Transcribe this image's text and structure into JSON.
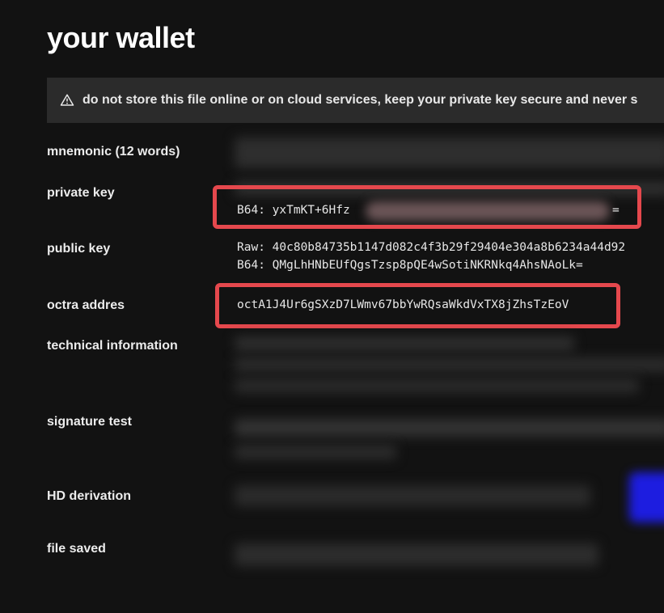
{
  "page": {
    "title": "your wallet"
  },
  "warning": {
    "icon": "warning-triangle-icon",
    "text": "do not store this file online or on cloud services, keep your private key secure and never s"
  },
  "fields": {
    "mnemonic_label": "mnemonic (12 words)",
    "private_key_label": "private key",
    "private_key_b64_prefix": "B64: yxTmKT+6Hfz",
    "private_key_b64_suffix": "=",
    "public_key_label": "public key",
    "public_key_raw": "Raw: 40c80b84735b1147d082c4f3b29f29404e304a8b6234a44d92",
    "public_key_b64": "B64: QMgLhHNbEUfQgsTzsp8pQE4wSotiNKRNkq4AhsNAoLk=",
    "octra_address_label": "octra addres",
    "octra_address": "octA1J4Ur6gSXzD7LWmv67bbYwRQsaWkdVxTX8jZhsTzEoV",
    "technical_information_label": "technical information",
    "signature_test_label": "signature test",
    "hd_derivation_label": "HD derivation",
    "file_saved_label": "file saved"
  },
  "colors": {
    "background": "#121212",
    "warning_bg": "#2b2b2b",
    "highlight_red": "#e5484d",
    "button_blue": "#1d1de0"
  }
}
